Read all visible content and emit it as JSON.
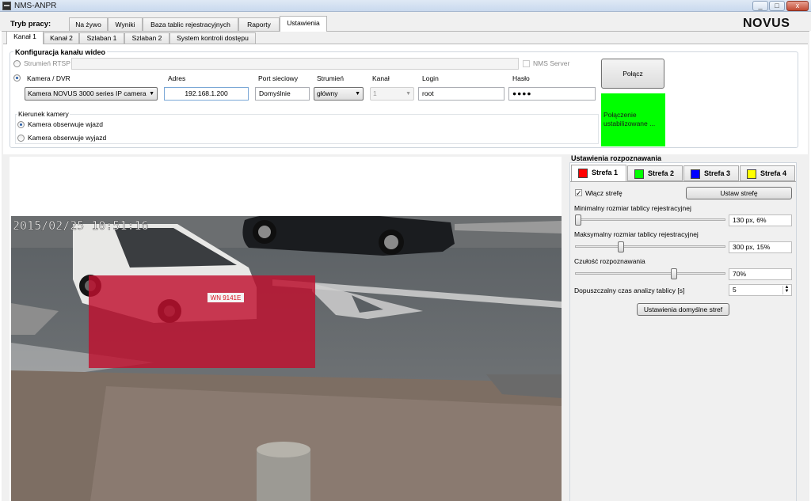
{
  "window": {
    "title": "NMS-ANPR",
    "controls": [
      "_",
      "□",
      "x"
    ]
  },
  "mode": {
    "label": "Tryb pracy:",
    "tabs": [
      "Na żywo",
      "Wyniki",
      "Baza tablic rejestracyjnych",
      "Raporty",
      "Ustawienia"
    ],
    "active": "Ustawienia"
  },
  "brand": "NOVUS",
  "channel_tabs": {
    "items": [
      "Kanał 1",
      "Kanał 2",
      "Szlaban 1",
      "Szlaban 2",
      "System kontroli dostępu"
    ],
    "active": "Kanał 1"
  },
  "config": {
    "title": "Konfiguracja kanału wideo",
    "rtsp_label": "Strumień RTSP",
    "rtsp_value": "",
    "nms_server_label": "NMS Server",
    "camera_dvr_label": "Kamera / DVR",
    "camera_model": "Kamera NOVUS 3000 series IP camera",
    "address_label": "Adres",
    "address_value": "192.168.1.200",
    "port_label": "Port sieciowy",
    "port_value": "Domyślnie",
    "stream_label": "Strumień",
    "stream_value": "główny",
    "channel_label": "Kanał",
    "channel_value": "1",
    "login_label": "Login",
    "login_value": "root",
    "password_label": "Hasło",
    "password_value": "●●●●",
    "connect_button": "Połącz",
    "status_text_line1": "Połączenie",
    "status_text_line2": "ustabilizowane ...",
    "status_color": "#00ff00",
    "direction_label": "Kierunek kamery",
    "direction_in": "Kamera obserwuje wjazd",
    "direction_out": "Kamera obserwuje wyjazd",
    "direction_selected": "in"
  },
  "video": {
    "timestamp": "2015/02/25 10:51:16",
    "plate_text": "WN 9141E",
    "zone_overlay_color": "#c0102e"
  },
  "recognition": {
    "title": "Ustawienia rozpoznawania",
    "zones": [
      {
        "label": "Strefa 1",
        "color": "#ff0000"
      },
      {
        "label": "Strefa 2",
        "color": "#00ff00"
      },
      {
        "label": "Strefa 3",
        "color": "#0000ff"
      },
      {
        "label": "Strefa 4",
        "color": "#ffff00"
      }
    ],
    "active_zone": "Strefa 1",
    "enable_zone_label": "Włącz strefę",
    "enable_zone_checked": true,
    "set_zone_button": "Ustaw strefę",
    "min_plate_label": "Minimalny rozmiar tablicy rejestracyjnej",
    "min_plate_value": "130 px, 6%",
    "min_plate_level": 0.02,
    "max_plate_label": "Maksymalny rozmiar tablicy rejestracyjnej",
    "max_plate_value": "300 px, 15%",
    "max_plate_level": 0.3,
    "sensitivity_label": "Czułość rozpoznawania",
    "sensitivity_value": "70%",
    "sensitivity_level": 0.7,
    "analysis_time_label": "Dopuszczalny czas analizy tablicy [s]",
    "analysis_time_value": "5",
    "default_zones_button": "Ustawienia domyślne stref"
  }
}
